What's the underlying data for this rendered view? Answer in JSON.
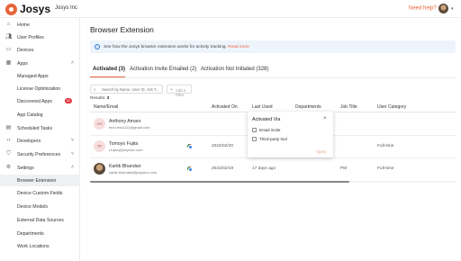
{
  "header": {
    "logo_text": "Josys",
    "org_name": "Josys Inc",
    "help_label": "Need help?",
    "help_icon": "question-circle-icon",
    "brand_color": "#e8633a"
  },
  "sidebar": {
    "items": [
      {
        "label": "Home",
        "icon": "home-icon"
      },
      {
        "label": "User Profiles",
        "icon": "users-icon"
      },
      {
        "label": "Devices",
        "icon": "laptop-icon"
      },
      {
        "label": "Apps",
        "icon": "grid-icon"
      },
      {
        "label": "Managed Apps"
      },
      {
        "label": "License Optimization"
      },
      {
        "label": "Discovered Apps",
        "badge": "32"
      },
      {
        "label": "App Catalog"
      },
      {
        "label": "Scheduled Tasks",
        "icon": "calendar-icon"
      },
      {
        "label": "Developers",
        "icon": "code-icon"
      },
      {
        "label": "Security Preferences",
        "icon": "shield-icon"
      },
      {
        "label": "Settings",
        "icon": "gear-icon"
      },
      {
        "label": "Browser Extension"
      },
      {
        "label": "Device Custom Fields"
      },
      {
        "label": "Device Models"
      },
      {
        "label": "External Data Sources"
      },
      {
        "label": "Departments"
      },
      {
        "label": "Work Locations"
      }
    ]
  },
  "page": {
    "title": "Browser Extension",
    "info_text": "See how the Josys browser extension works for activity tracking.",
    "info_link": "Read more"
  },
  "tabs": [
    {
      "label": "Activated (3)"
    },
    {
      "label": "Activation Invite Emailed (2)"
    },
    {
      "label": "Activation Not Initiated (328)"
    }
  ],
  "search": {
    "placeholder": "Search by Name, User ID, Job T..."
  },
  "filter": {
    "label": "Add a Filter"
  },
  "results": {
    "label": "Results:",
    "count": "3"
  },
  "table": {
    "headers": [
      "Name/Email",
      "Activated On",
      "Last Used",
      "Departments",
      "Job Title",
      "User Category"
    ],
    "rows": [
      {
        "initials": "AA",
        "name": "Anthony Amaro",
        "email": "tech.test1111@gmail.com",
        "browser": "chrome-icon",
        "activated_on": "",
        "last_used": "",
        "departments": "",
        "job_title": "",
        "category": ""
      },
      {
        "initials": "TF",
        "name": "Tomoyo Fujita",
        "email": "t.fujita@josysinc.com",
        "browser": "chrome-icon",
        "activated_on": "2024/02/20",
        "last_used": "2024/02/20",
        "departments": "",
        "job_title": "",
        "category": "Full-time"
      },
      {
        "initials": "",
        "name": "Kartik Bhandari",
        "email": "kartik.bhandari@josysinc.com",
        "browser": "chrome-icon",
        "activated_on": "2024/02/19",
        "last_used": "17 days ago",
        "departments": "",
        "job_title": "PM",
        "category": "Full-time"
      }
    ]
  },
  "popover": {
    "title": "Activated Via",
    "options": [
      "Email invite",
      "Third-party tool"
    ],
    "apply": "Apply",
    "close_icon": "close-icon"
  }
}
